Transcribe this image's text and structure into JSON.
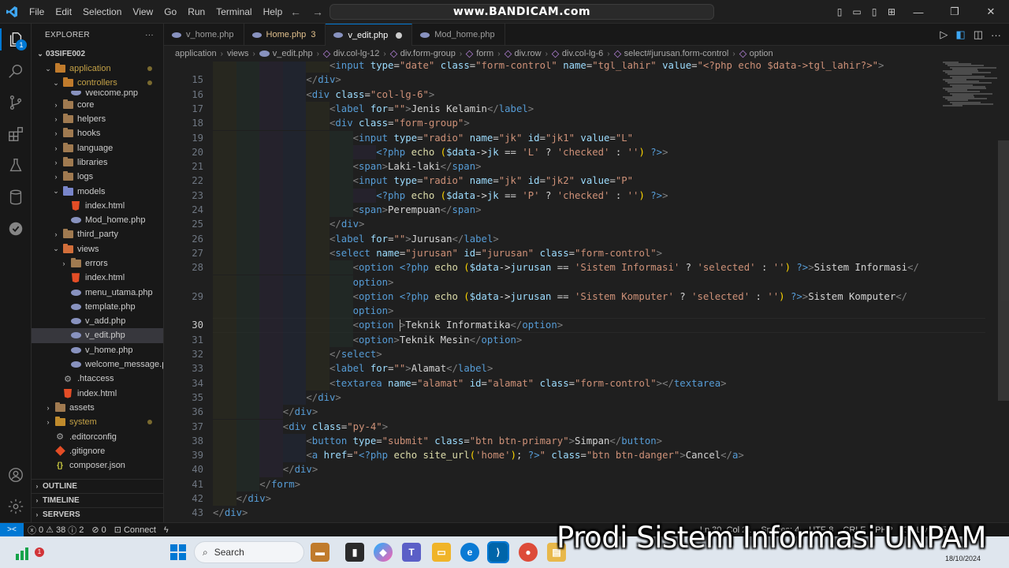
{
  "menu": [
    "File",
    "Edit",
    "Selection",
    "View",
    "Go",
    "Run",
    "Terminal",
    "Help"
  ],
  "watermark": "www.BANDICAM.com",
  "explorer": {
    "title": "EXPLORER",
    "root": "03SIFE002",
    "items": [
      {
        "label": "application",
        "type": "folder",
        "open": true,
        "color": "#c2a046",
        "level": 1,
        "modified": true
      },
      {
        "label": "controllers",
        "type": "folder",
        "open": true,
        "color": "#c2a046",
        "level": 2,
        "modified": true
      },
      {
        "label": "Welcome.php",
        "type": "php",
        "level": 3,
        "clipped": true
      },
      {
        "label": "core",
        "type": "folder",
        "open": false,
        "color": "#cccccc",
        "level": 2
      },
      {
        "label": "helpers",
        "type": "folder",
        "open": false,
        "color": "#cccccc",
        "level": 2
      },
      {
        "label": "hooks",
        "type": "folder",
        "open": false,
        "color": "#cccccc",
        "level": 2
      },
      {
        "label": "language",
        "type": "folder",
        "open": false,
        "color": "#cccccc",
        "level": 2
      },
      {
        "label": "libraries",
        "type": "folder",
        "open": false,
        "color": "#cccccc",
        "level": 2
      },
      {
        "label": "logs",
        "type": "folder",
        "open": false,
        "color": "#cccccc",
        "level": 2
      },
      {
        "label": "models",
        "type": "folder",
        "open": true,
        "color": "#cccccc",
        "level": 2
      },
      {
        "label": "index.html",
        "type": "html",
        "level": 3
      },
      {
        "label": "Mod_home.php",
        "type": "php",
        "level": 3
      },
      {
        "label": "third_party",
        "type": "folder",
        "open": false,
        "color": "#cccccc",
        "level": 2
      },
      {
        "label": "views",
        "type": "folder",
        "open": true,
        "color": "#cccccc",
        "level": 2
      },
      {
        "label": "errors",
        "type": "folder",
        "open": false,
        "color": "#cccccc",
        "level": 3
      },
      {
        "label": "index.html",
        "type": "html",
        "level": 3
      },
      {
        "label": "menu_utama.php",
        "type": "php",
        "level": 3
      },
      {
        "label": "template.php",
        "type": "php",
        "level": 3
      },
      {
        "label": "v_add.php",
        "type": "php",
        "level": 3
      },
      {
        "label": "v_edit.php",
        "type": "php",
        "level": 3,
        "selected": true
      },
      {
        "label": "v_home.php",
        "type": "php",
        "level": 3
      },
      {
        "label": "welcome_message.p...",
        "type": "php",
        "level": 3
      },
      {
        "label": ".htaccess",
        "type": "gear",
        "level": 2
      },
      {
        "label": "index.html",
        "type": "html",
        "level": 2
      },
      {
        "label": "assets",
        "type": "folder",
        "open": false,
        "color": "#cccccc",
        "level": 1
      },
      {
        "label": "system",
        "type": "folder",
        "open": false,
        "color": "#c2a046",
        "level": 1,
        "modified": true
      },
      {
        "label": ".editorconfig",
        "type": "gear",
        "level": 1
      },
      {
        "label": ".gitignore",
        "type": "git",
        "level": 1
      },
      {
        "label": "composer.json",
        "type": "json",
        "level": 1
      }
    ],
    "sections": [
      "OUTLINE",
      "TIMELINE",
      "SERVERS"
    ]
  },
  "tabs": [
    {
      "label": "v_home.php",
      "active": false
    },
    {
      "label": "Home.php",
      "active": false,
      "badge": "3"
    },
    {
      "label": "v_edit.php",
      "active": true,
      "dirty": true
    },
    {
      "label": "Mod_home.php",
      "active": false
    }
  ],
  "breadcrumb": [
    "application",
    "views",
    "v_edit.php",
    "div.col-lg-12",
    "div.form-group",
    "form",
    "div.row",
    "div.col-lg-6",
    "select#jurusan.form-control",
    "option"
  ],
  "editor": {
    "current_line": 30,
    "lines": [
      {
        "n": "",
        "indent": 5,
        "html": "<span class='p'>&lt;</span><span class='t'>input</span> <span class='a'>type</span>=<span class='s'>\"date\"</span> <span class='a'>class</span>=<span class='s'>\"form-control\"</span> <span class='a'>name</span>=<span class='s'>\"tgl_lahir\"</span> <span class='a'>value</span>=<span class='s'>\"&lt;?php echo $data-&gt;tgl_lahir?&gt;\"</span><span class='p'>&gt;</span>",
        "clip": true
      },
      {
        "n": "15",
        "indent": 4,
        "html": "<span class='p'>&lt;/</span><span class='t'>div</span><span class='p'>&gt;</span>"
      },
      {
        "n": "16",
        "indent": 4,
        "html": "<span class='p'>&lt;</span><span class='t'>div</span> <span class='a'>class</span>=<span class='s'>\"col-lg-6\"</span><span class='p'>&gt;</span>"
      },
      {
        "n": "17",
        "indent": 5,
        "html": "<span class='p'>&lt;</span><span class='t'>label</span> <span class='a'>for</span>=<span class='s'>\"\"</span><span class='p'>&gt;</span><span class='tx'>Jenis Kelamin</span><span class='p'>&lt;/</span><span class='t'>label</span><span class='p'>&gt;</span>"
      },
      {
        "n": "18",
        "indent": 5,
        "html": "<span class='p'>&lt;</span><span class='t'>div</span> <span class='a'>class</span>=<span class='s'>\"form-group\"</span><span class='p'>&gt;</span>"
      },
      {
        "n": "19",
        "indent": 6,
        "html": "<span class='p'>&lt;</span><span class='t'>input</span> <span class='a'>type</span>=<span class='s'>\"radio\"</span> <span class='a'>name</span>=<span class='s'>\"jk\"</span> <span class='a'>id</span>=<span class='s'>\"jk1\"</span> <span class='a'>value</span>=<span class='s'>\"L\"</span>"
      },
      {
        "n": "20",
        "indent": 7,
        "html": "<span class='kw'>&lt;?php</span> <span class='fn'>echo</span> <span class='br'>(</span><span class='var'>$data</span><span class='tx'>-&gt;</span><span class='var'>jk</span> <span class='tx'>==</span> <span class='s'>'L'</span> <span class='tx'>?</span> <span class='s'>'checked'</span> <span class='tx'>:</span> <span class='s'>''</span><span class='br'>)</span> <span class='kw'>?&gt;</span><span class='p'>&gt;</span>"
      },
      {
        "n": "21",
        "indent": 6,
        "html": "<span class='p'>&lt;</span><span class='t'>span</span><span class='p'>&gt;</span><span class='tx'>Laki-laki</span><span class='p'>&lt;/</span><span class='t'>span</span><span class='p'>&gt;</span>"
      },
      {
        "n": "22",
        "indent": 6,
        "html": "<span class='p'>&lt;</span><span class='t'>input</span> <span class='a'>type</span>=<span class='s'>\"radio\"</span> <span class='a'>name</span>=<span class='s'>\"jk\"</span> <span class='a'>id</span>=<span class='s'>\"jk2\"</span> <span class='a'>value</span>=<span class='s'>\"P\"</span>"
      },
      {
        "n": "23",
        "indent": 7,
        "html": "<span class='kw'>&lt;?php</span> <span class='fn'>echo</span> <span class='br'>(</span><span class='var'>$data</span><span class='tx'>-&gt;</span><span class='var'>jk</span> <span class='tx'>==</span> <span class='s'>'P'</span> <span class='tx'>?</span> <span class='s'>'checked'</span> <span class='tx'>:</span> <span class='s'>''</span><span class='br'>)</span> <span class='kw'>?&gt;</span><span class='p'>&gt;</span>"
      },
      {
        "n": "24",
        "indent": 6,
        "html": "<span class='p'>&lt;</span><span class='t'>span</span><span class='p'>&gt;</span><span class='tx'>Perempuan</span><span class='p'>&lt;/</span><span class='t'>span</span><span class='p'>&gt;</span>"
      },
      {
        "n": "25",
        "indent": 5,
        "html": "<span class='p'>&lt;/</span><span class='t'>div</span><span class='p'>&gt;</span>"
      },
      {
        "n": "26",
        "indent": 5,
        "html": "<span class='p'>&lt;</span><span class='t'>label</span> <span class='a'>for</span>=<span class='s'>\"\"</span><span class='p'>&gt;</span><span class='tx'>Jurusan</span><span class='p'>&lt;/</span><span class='t'>label</span><span class='p'>&gt;</span>"
      },
      {
        "n": "27",
        "indent": 5,
        "html": "<span class='p'>&lt;</span><span class='t'>select</span> <span class='a'>name</span>=<span class='s'>\"jurusan\"</span> <span class='a'>id</span>=<span class='s'>\"jurusan\"</span> <span class='a'>class</span>=<span class='s'>\"form-control\"</span><span class='p'>&gt;</span>"
      },
      {
        "n": "28",
        "indent": 6,
        "html": "<span class='p'>&lt;</span><span class='t'>option</span> <span class='kw'>&lt;?php</span> <span class='fn'>echo</span> <span class='br'>(</span><span class='var'>$data</span><span class='tx'>-&gt;</span><span class='var'>jurusan</span> <span class='tx'>==</span> <span class='s'>'Sistem Informasi'</span> <span class='tx'>?</span> <span class='s'>'selected'</span> <span class='tx'>:</span> <span class='s'>''</span><span class='br'>)</span> <span class='kw'>?&gt;</span><span class='p'>&gt;</span><span class='tx'>Sistem Informasi</span><span class='p'>&lt;/</span>"
      },
      {
        "n": "",
        "indent": 6,
        "html": "<span class='t'>option</span><span class='p'>&gt;</span>"
      },
      {
        "n": "29",
        "indent": 6,
        "html": "<span class='p'>&lt;</span><span class='t'>option</span> <span class='kw'>&lt;?php</span> <span class='fn'>echo</span> <span class='br'>(</span><span class='var'>$data</span><span class='tx'>-&gt;</span><span class='var'>jurusan</span> <span class='tx'>==</span> <span class='s'>'Sistem Komputer'</span> <span class='tx'>?</span> <span class='s'>'selected'</span> <span class='tx'>:</span> <span class='s'>''</span><span class='br'>)</span> <span class='kw'>?&gt;</span><span class='p'>&gt;</span><span class='tx'>Sistem Komputer</span><span class='p'>&lt;/</span>"
      },
      {
        "n": "",
        "indent": 6,
        "html": "<span class='t'>option</span><span class='p'>&gt;</span>"
      },
      {
        "n": "30",
        "indent": 6,
        "html": "<span class='p'>&lt;</span><span class='t'>option</span> <span class='p'>&gt;</span><span class='tx'>Teknik Informatika</span><span class='p'>&lt;/</span><span class='t'>option</span><span class='p'>&gt;</span>"
      },
      {
        "n": "31",
        "indent": 6,
        "html": "<span class='p'>&lt;</span><span class='t'>option</span><span class='p'>&gt;</span><span class='tx'>Teknik Mesin</span><span class='p'>&lt;/</span><span class='t'>option</span><span class='p'>&gt;</span>"
      },
      {
        "n": "32",
        "indent": 5,
        "html": "<span class='p'>&lt;/</span><span class='t'>select</span><span class='p'>&gt;</span>"
      },
      {
        "n": "33",
        "indent": 5,
        "html": "<span class='p'>&lt;</span><span class='t'>label</span> <span class='a'>for</span>=<span class='s'>\"\"</span><span class='p'>&gt;</span><span class='tx'>Alamat</span><span class='p'>&lt;/</span><span class='t'>label</span><span class='p'>&gt;</span>"
      },
      {
        "n": "34",
        "indent": 5,
        "html": "<span class='p'>&lt;</span><span class='t'>textarea</span> <span class='a'>name</span>=<span class='s'>\"alamat\"</span> <span class='a'>id</span>=<span class='s'>\"alamat\"</span> <span class='a'>class</span>=<span class='s'>\"form-control\"</span><span class='p'>&gt;&lt;/</span><span class='t'>textarea</span><span class='p'>&gt;</span>"
      },
      {
        "n": "35",
        "indent": 4,
        "html": "<span class='p'>&lt;/</span><span class='t'>div</span><span class='p'>&gt;</span>"
      },
      {
        "n": "36",
        "indent": 3,
        "html": "<span class='p'>&lt;/</span><span class='t'>div</span><span class='p'>&gt;</span>"
      },
      {
        "n": "37",
        "indent": 3,
        "html": "<span class='p'>&lt;</span><span class='t'>div</span> <span class='a'>class</span>=<span class='s'>\"py-4\"</span><span class='p'>&gt;</span>"
      },
      {
        "n": "38",
        "indent": 4,
        "html": "<span class='p'>&lt;</span><span class='t'>button</span> <span class='a'>type</span>=<span class='s'>\"submit\"</span> <span class='a'>class</span>=<span class='s'>\"btn btn-primary\"</span><span class='p'>&gt;</span><span class='tx'>Simpan</span><span class='p'>&lt;/</span><span class='t'>button</span><span class='p'>&gt;</span>"
      },
      {
        "n": "39",
        "indent": 4,
        "html": "<span class='p'>&lt;</span><span class='t'>a</span> <span class='a'>href</span>=<span class='s'>\"</span><span class='kw'>&lt;?php</span> <span class='fn'>echo</span> <span class='fn'>site_url</span><span class='br'>(</span><span class='s'>'home'</span><span class='br'>)</span><span class='tx'>;</span> <span class='kw'>?&gt;</span><span class='s'>\"</span> <span class='a'>class</span>=<span class='s'>\"btn btn-danger\"</span><span class='p'>&gt;</span><span class='tx'>Cancel</span><span class='p'>&lt;/</span><span class='t'>a</span><span class='p'>&gt;</span>"
      },
      {
        "n": "40",
        "indent": 3,
        "html": "<span class='p'>&lt;/</span><span class='t'>div</span><span class='p'>&gt;</span>"
      },
      {
        "n": "41",
        "indent": 2,
        "html": "<span class='p'>&lt;/</span><span class='t'>form</span><span class='p'>&gt;</span>"
      },
      {
        "n": "42",
        "indent": 1,
        "html": "<span class='p'>&lt;/</span><span class='t'>div</span><span class='p'>&gt;</span>"
      },
      {
        "n": "43",
        "indent": 0,
        "html": "<span class='p'>&lt;/</span><span class='t'>div</span><span class='p'>&gt;</span>"
      }
    ]
  },
  "status": {
    "remote": "><",
    "errors": "0",
    "warnings": "38",
    "info": "2",
    "ports": "0",
    "connect": "Connect",
    "right": [
      "Ln 30, Col 21",
      "Spaces: 4",
      "UTF-8",
      "CRLF",
      "PHP",
      "Go Live",
      "5.3"
    ]
  },
  "taskbar": {
    "search_placeholder": "Search",
    "date": "18/10/2024",
    "weather_badge": "1"
  },
  "overlay_text": "Prodi Sistem Informasi UNPAM"
}
